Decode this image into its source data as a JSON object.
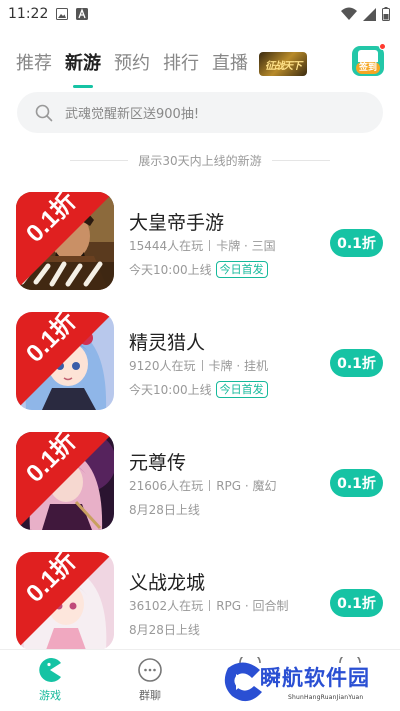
{
  "status_bar": {
    "time": "11:22"
  },
  "top_tabs": {
    "items": [
      "推荐",
      "新游",
      "预约",
      "排行",
      "直播"
    ],
    "active_index": 1,
    "banner_text": "征战天下",
    "signin_label": "签到"
  },
  "search": {
    "placeholder": "武魂觉醒新区送900抽!"
  },
  "section_note": "展示30天内上线的新游",
  "games": [
    {
      "name": "大皇帝手游",
      "players": "15444人在玩",
      "tags": "卡牌 · 三国",
      "date": "今天10:00上线",
      "tag_label": "今日首发",
      "discount": "0.1折",
      "corner": "0.1折",
      "icon": "warlord-game-icon"
    },
    {
      "name": "精灵猎人",
      "players": "9120人在玩",
      "tags": "卡牌 · 挂机",
      "date": "今天10:00上线",
      "tag_label": "今日首发",
      "discount": "0.1折",
      "corner": "0.1折",
      "icon": "elf-girl-game-icon"
    },
    {
      "name": "元尊传",
      "players": "21606人在玩",
      "tags": "RPG · 魔幻",
      "date": "8月28日上线",
      "discount": "0.1折",
      "corner": "0.1折",
      "icon": "sorceress-game-icon"
    },
    {
      "name": "义战龙城",
      "players": "36102人在玩",
      "tags": "RPG · 回合制",
      "date": "8月28日上线",
      "discount": "0.1折",
      "corner": "0.1折",
      "icon": "princess-game-icon"
    }
  ],
  "bottom_nav": {
    "items": [
      "游戏",
      "群聊"
    ],
    "active_index": 0
  },
  "watermark": {
    "text": "瞬航软件园",
    "sub": "ShunHangRuanJianYuan"
  },
  "colors": {
    "accent": "#16c3a4",
    "text": "#222222",
    "muted": "#999999"
  }
}
